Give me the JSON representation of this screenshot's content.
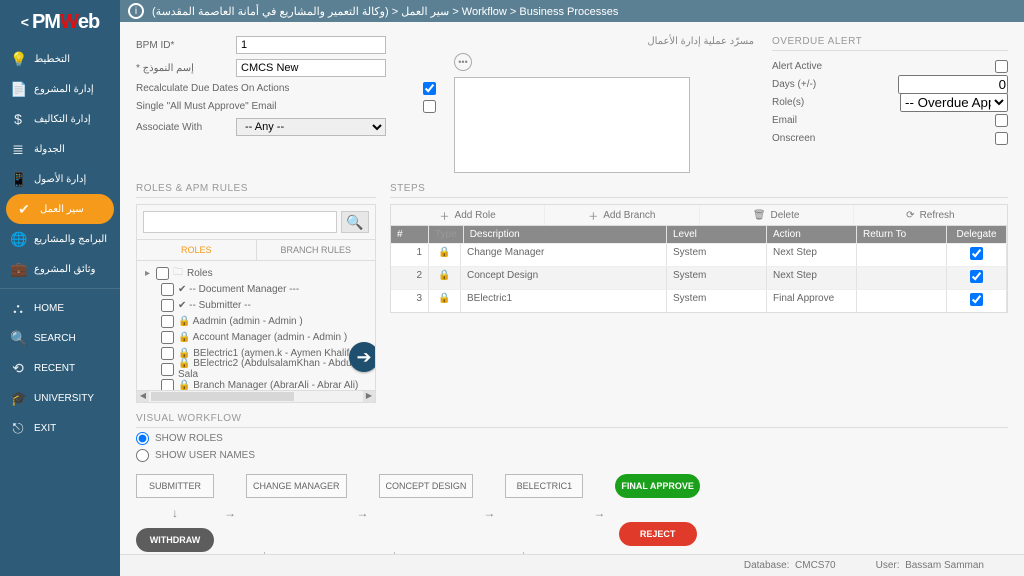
{
  "brand": {
    "p": "PM",
    "w": "W",
    "eb": "eb"
  },
  "breadcrumb": "(وكالة التعمير والمشاريع في أمانة العاصمة المقدسة) > سير العمل > Workflow > Business Processes",
  "sidebar": {
    "items": [
      {
        "icon": "💡",
        "label": "التخطيط"
      },
      {
        "icon": "📄",
        "label": "إدارة المشروع"
      },
      {
        "icon": "$",
        "label": "إدارة التكاليف"
      },
      {
        "icon": "≣",
        "label": "الجدولة"
      },
      {
        "icon": "📱",
        "label": "إدارة الأصول"
      },
      {
        "icon": "✔",
        "label": "سير العمل"
      },
      {
        "icon": "🌐",
        "label": "البرامج والمشاريع"
      },
      {
        "icon": "💼",
        "label": "وثائق المشروع"
      }
    ],
    "bottom": [
      {
        "icon": "⛬",
        "label": "HOME"
      },
      {
        "icon": "🔍",
        "label": "SEARCH"
      },
      {
        "icon": "⟲",
        "label": "RECENT"
      },
      {
        "icon": "🎓",
        "label": "UNIVERSITY"
      },
      {
        "icon": "⎋",
        "label": "EXIT"
      }
    ]
  },
  "form": {
    "bpm_id_label": "BPM ID*",
    "bpm_id": "1",
    "name_label": "إسم النموذج *",
    "name": "CMCS New",
    "recalc_label": "Recalculate Due Dates On Actions",
    "single_label": "Single \"All Must Approve\" Email",
    "assoc_label": "Associate With",
    "assoc_value": "-- Any --"
  },
  "mid": {
    "title": "مسرّد عملية إدارة الأعمال"
  },
  "alert": {
    "title": "OVERDUE ALERT",
    "active_label": "Alert Active",
    "days_label": "Days (+/-)",
    "days_value": "0",
    "roles_label": "Role(s)",
    "roles_value": "-- Overdue Approver --",
    "email_label": "Email",
    "onscreen_label": "Onscreen"
  },
  "roles_panel": {
    "title": "ROLES & APM RULES",
    "tab_roles": "ROLES",
    "tab_branch": "BRANCH RULES",
    "root": "Roles",
    "list": [
      "✔ -- Document Manager ---",
      "✔ -- Submitter --",
      "🔒 Aadmin (admin - Admin )",
      "🔒 Account Manager (admin - Admin )",
      "🔒 BElectric1 (aymen.k - Aymen Khalifa)",
      "🔒 BElectric2 (AbdulsalamKhan - Abdul Sala",
      "🔒 Branch Manager (AbrarAli - Abrar Ali)"
    ]
  },
  "steps_panel": {
    "title": "STEPS",
    "toolbar": {
      "add_role": "Add Role",
      "add_branch": "Add Branch",
      "delete": "Delete",
      "refresh": "Refresh"
    },
    "headers": {
      "num": "#",
      "type": "Type",
      "desc": "Description",
      "level": "Level",
      "action": "Action",
      "return": "Return To",
      "delegate": "Delegate"
    },
    "rows": [
      {
        "n": "1",
        "desc": "Change Manager",
        "level": "System",
        "action": "Next Step"
      },
      {
        "n": "2",
        "desc": "Concept Design",
        "level": "System",
        "action": "Next Step"
      },
      {
        "n": "3",
        "desc": "BElectric1",
        "level": "System",
        "action": "Final Approve"
      }
    ]
  },
  "vw": {
    "title": "VISUAL WORKFLOW",
    "show_roles": "SHOW ROLES",
    "show_users": "SHOW USER NAMES",
    "nodes": {
      "submitter": "SUBMITTER",
      "change": "CHANGE MANAGER",
      "concept": "CONCEPT DESIGN",
      "belectric": "BELECTRIC1",
      "final": "FINAL APPROVE",
      "withdraw": "WITHDRAW",
      "reject": "REJECT"
    }
  },
  "footer": {
    "db_label": "Database:",
    "db": "CMCS70",
    "user_label": "User:",
    "user": "Bassam Samman"
  }
}
